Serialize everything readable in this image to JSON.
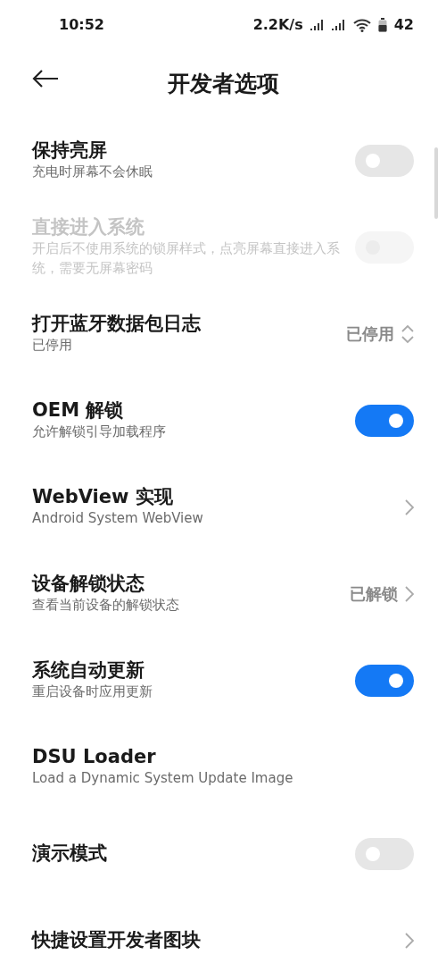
{
  "status_bar": {
    "time": "10:52",
    "speed": "2.2K/s",
    "battery": "42"
  },
  "header": {
    "title": "开发者选项"
  },
  "settings": [
    {
      "kind": "switch",
      "title": "保持亮屏",
      "subtitle": "充电时屏幕不会休眠",
      "on": false,
      "disabled": false
    },
    {
      "kind": "switch",
      "title": "直接进入系统",
      "subtitle": "开启后不使用系统的锁屏样式，点亮屏幕直接进入系统，需要无屏幕密码",
      "on": false,
      "disabled": true
    },
    {
      "kind": "dropdown",
      "title": "打开蓝牙数据包日志",
      "subtitle": "已停用",
      "value": "已停用"
    },
    {
      "kind": "switch",
      "title": "OEM 解锁",
      "subtitle": "允许解锁引导加载程序",
      "on": true,
      "disabled": false
    },
    {
      "kind": "link",
      "title": "WebView 实现",
      "subtitle": "Android System WebView"
    },
    {
      "kind": "link",
      "title": "设备解锁状态",
      "subtitle": "查看当前设备的解锁状态",
      "value": "已解锁"
    },
    {
      "kind": "switch",
      "title": "系统自动更新",
      "subtitle": "重启设备时应用更新",
      "on": true,
      "disabled": false
    },
    {
      "kind": "plain",
      "title": "DSU Loader",
      "subtitle": "Load a Dynamic System Update Image"
    },
    {
      "kind": "switch",
      "title": "演示模式",
      "on": false,
      "disabled": false
    },
    {
      "kind": "link",
      "title": "快捷设置开发者图块"
    }
  ]
}
